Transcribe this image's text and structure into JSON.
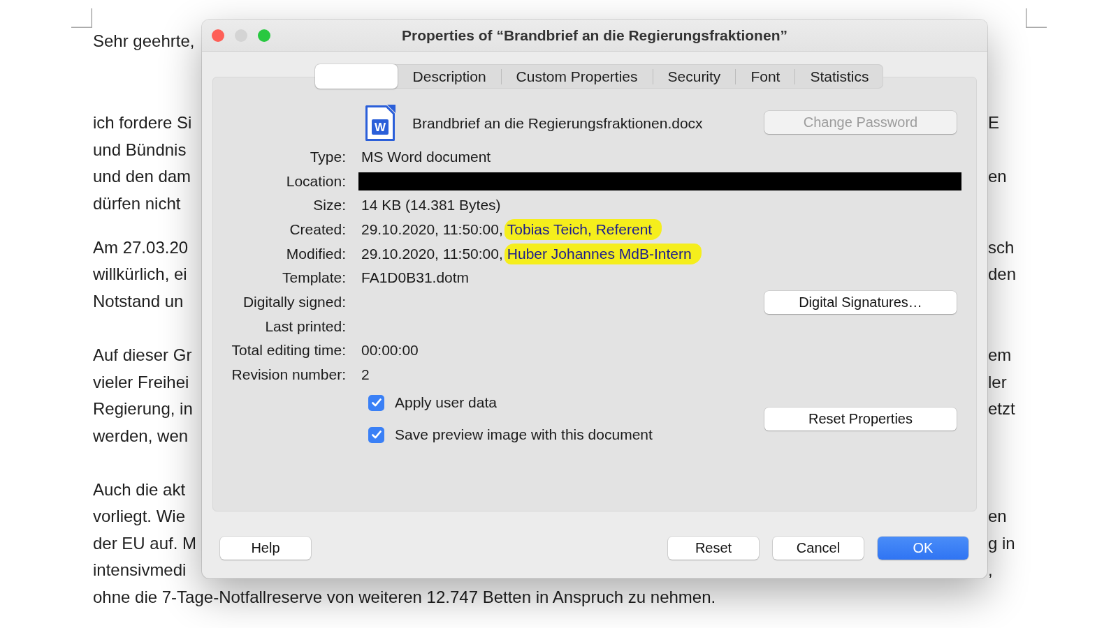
{
  "document": {
    "paragraphs": [
      {
        "lines": [
          {
            "start": "Sehr geehrte,"
          }
        ]
      },
      {
        "lines": [
          {
            "start": "ich fordere Si",
            "end": "E"
          },
          {
            "start": "und Bündnis"
          },
          {
            "start": "und den dam",
            "end": "en"
          },
          {
            "start": "dürfen nicht"
          }
        ]
      },
      {
        "lines": [
          {
            "start": "Am 27.03.20",
            "end": "sch"
          },
          {
            "start": "willkürlich, ei",
            "end": "den"
          },
          {
            "start": "Notstand un"
          }
        ]
      },
      {
        "lines": [
          {
            "start": "Auf dieser Gr",
            "end": "em"
          },
          {
            "start": "vieler Freihei",
            "end": "ler"
          },
          {
            "start": "Regierung, in",
            "end": "etzt"
          },
          {
            "start": "werden, wen"
          }
        ]
      },
      {
        "lines": [
          {
            "start": "Auch die akt"
          },
          {
            "start": "vorliegt. Wie",
            "end": "en"
          },
          {
            "start": "der EU auf. M",
            "end": "g in"
          },
          {
            "start": "intensivmedi",
            "end": ","
          },
          {
            "start": "ohne die 7-Tage-Notfallreserve von weiteren 12.747 Betten in Anspruch zu nehmen."
          }
        ]
      }
    ]
  },
  "window": {
    "title": "Properties of “Brandbrief an die Regierungsfraktionen”",
    "controls": [
      {
        "kind": "close",
        "disabled": false
      },
      {
        "kind": "minimize",
        "disabled": true
      },
      {
        "kind": "zoom",
        "disabled": false
      }
    ]
  },
  "tabs": [
    {
      "selected": true
    },
    {
      "label": "Description",
      "selected": false
    },
    {
      "label": "Custom Properties",
      "selected": false
    },
    {
      "label": "Security",
      "selected": false
    },
    {
      "label": "Font",
      "selected": false
    },
    {
      "label": "Statistics",
      "selected": false
    }
  ],
  "file": {
    "icon_letter": "W",
    "name": "Brandbrief an die Regierungsfraktionen.docx",
    "button": {
      "label": "Change Password",
      "disabled": true
    }
  },
  "fields": [
    {
      "label": "Type:",
      "value": "MS Word document"
    },
    {
      "label": "Location:",
      "redacted": true
    },
    {
      "label": "Size:",
      "value": "14 KB (14.381 Bytes)"
    },
    {
      "label": "Created:",
      "value": "29.10.2020, 11:50:00,",
      "author": "Tobias Teich, Referent",
      "highlighted": true
    },
    {
      "label": "Modified:",
      "value": "29.10.2020, 11:50:00,",
      "author": "Huber Johannes MdB-Intern",
      "highlighted": true
    },
    {
      "label": "Template:",
      "value": "FA1D0B31.dotm"
    },
    {
      "label": "Digitally signed:",
      "button": {
        "label": "Digital Signatures…",
        "disabled": false
      }
    },
    {
      "label": "Last printed:"
    },
    {
      "label": "Total editing time:",
      "value": "00:00:00"
    },
    {
      "label": "Revision number:",
      "value": "2"
    }
  ],
  "options": [
    {
      "label": "Apply user data",
      "checked": true
    },
    {
      "label": "Save preview image with this document",
      "checked": true
    }
  ],
  "reset_properties_button": {
    "label": "Reset Properties"
  },
  "help_button": {
    "label": "Help"
  },
  "buttons": [
    {
      "label": "Reset",
      "default": false
    },
    {
      "label": "Cancel",
      "default": false
    },
    {
      "label": "OK",
      "default": true
    }
  ]
}
